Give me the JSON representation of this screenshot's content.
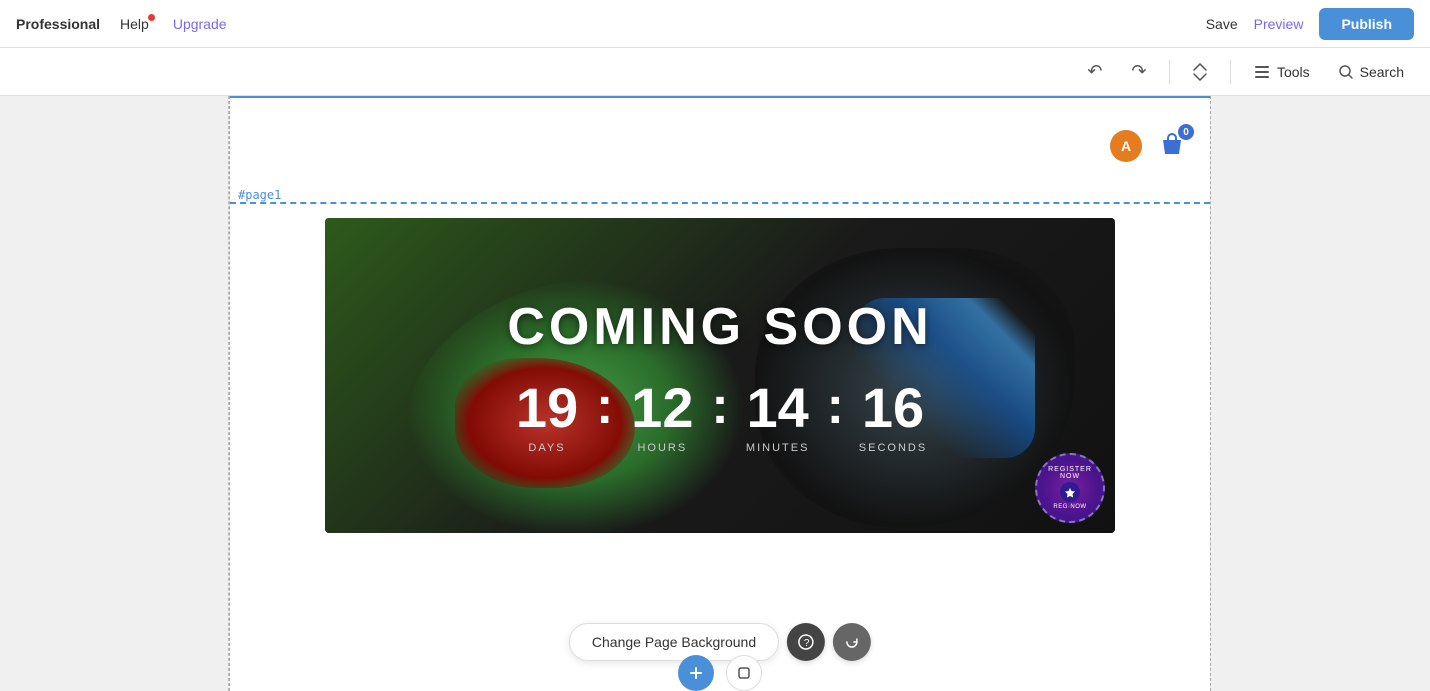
{
  "nav": {
    "brand": "Professional",
    "help_label": "Help",
    "upgrade_label": "Upgrade",
    "save_label": "Save",
    "preview_label": "Preview",
    "publish_label": "Publish"
  },
  "toolbar": {
    "tools_label": "Tools",
    "search_label": "Search"
  },
  "canvas": {
    "page_label": "#page1",
    "cart_badge": "0",
    "avatar_letter": "A"
  },
  "banner": {
    "title": "COMING SOON",
    "countdown": {
      "days_value": "19",
      "days_label": "DAYS",
      "hours_value": "12",
      "hours_label": "HOURS",
      "minutes_value": "14",
      "minutes_label": "MINUTES",
      "seconds_value": "16",
      "seconds_label": "SECONDS",
      "sep": ":"
    },
    "stamp_text": "REGISTER NOW · REG·NOW ·"
  },
  "bottom_toolbar": {
    "change_bg_label": "Change Page Background"
  }
}
